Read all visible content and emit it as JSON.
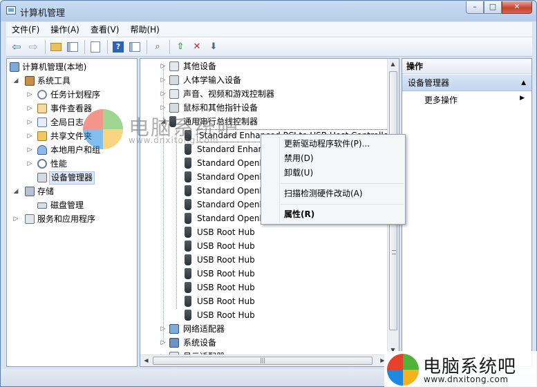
{
  "window": {
    "title": "计算机管理",
    "caption_buttons": {
      "minimize": "–",
      "maximize": "□",
      "close": "✕"
    }
  },
  "menubar": {
    "items": [
      "文件(F)",
      "操作(A)",
      "查看(V)",
      "帮助(H)"
    ]
  },
  "toolbar": {
    "icons": [
      "back-arrow-icon",
      "forward-arrow-icon",
      "folder-up-icon",
      "show-hide-tree-icon",
      "properties-sheet-icon",
      "help-icon",
      "action-pane-icon",
      "scan-hardware-icon",
      "update-driver-icon",
      "uninstall-icon",
      "disable-icon"
    ]
  },
  "left_tree": {
    "root": "计算机管理(本地)",
    "items": [
      {
        "label": "系统工具",
        "icon": "tools-icon"
      },
      {
        "label": "任务计划程序",
        "icon": "clock-icon"
      },
      {
        "label": "事件查看器",
        "icon": "event-viewer-icon"
      },
      {
        "label": "全局日志",
        "icon": "log-icon"
      },
      {
        "label": "共享文件夹",
        "icon": "shared-folder-icon"
      },
      {
        "label": "本地用户和组",
        "icon": "users-icon"
      },
      {
        "label": "性能",
        "icon": "performance-icon"
      },
      {
        "label": "设备管理器",
        "icon": "device-manager-icon"
      },
      {
        "label": "存储",
        "icon": "storage-icon"
      },
      {
        "label": "磁盘管理",
        "icon": "disk-icon"
      },
      {
        "label": "服务和应用程序",
        "icon": "services-icon"
      }
    ]
  },
  "device_tree": {
    "categories_top": [
      "其他设备",
      "人体学输入设备",
      "声音、视频和游戏控制器",
      "鼠标和其他指针设备",
      "通用串行总线控制器"
    ],
    "usb_children": [
      "Standard Enhanced PCI to USB Host Controller",
      "Standard Enhan",
      "Standard Openh",
      "Standard Openh",
      "Standard Openh",
      "Standard Openh",
      "Standard Openh",
      "USB Root Hub",
      "USB Root Hub",
      "USB Root Hub",
      "USB Root Hub",
      "USB Root Hub",
      "USB Root Hub",
      "USB Root Hub"
    ],
    "categories_bottom": [
      "网络适配器",
      "系统设备",
      "显示适配器"
    ]
  },
  "context_menu": {
    "items": [
      "更新驱动程序软件(P)...",
      "禁用(D)",
      "卸载(U)",
      "扫描检测硬件改动(A)",
      "属性(R)"
    ]
  },
  "actions_pane": {
    "header": "操作",
    "section": "设备管理器",
    "more": "更多操作"
  },
  "watermark": {
    "brand": "电脑系统吧",
    "url": "www.dnxitong.com",
    "center_brand": "电脑系统吧",
    "center_url": "www.dnxitong.com"
  },
  "colors": {
    "logo_red": "#e8402b",
    "logo_green": "#51b336",
    "logo_blue": "#1f88e0",
    "logo_yellow": "#f5b21b"
  }
}
